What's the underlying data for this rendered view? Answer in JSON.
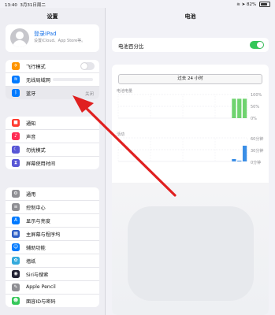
{
  "status": {
    "time": "13:40",
    "date": "3月31日周二",
    "battery": "82%",
    "battery_level": 0.82
  },
  "sidebar": {
    "title": "设置",
    "profile": {
      "title": "登录iPad",
      "subtitle": "设置iCloud、App Store等。"
    },
    "group1": [
      {
        "label": "飞行模式",
        "icon": "airplane-icon",
        "color": "#ff9500",
        "glyph": "✈"
      },
      {
        "label": "无线局域网",
        "icon": "wifi-icon",
        "color": "#007aff",
        "glyph": "≋"
      },
      {
        "label": "蓝牙",
        "icon": "bluetooth-icon",
        "color": "#007aff",
        "glyph": "ᛒ",
        "value": "关闭"
      }
    ],
    "group2": [
      {
        "label": "通知",
        "icon": "notification-icon",
        "color": "#ff3b30",
        "glyph": "■"
      },
      {
        "label": "声音",
        "icon": "sound-icon",
        "color": "#ff2d55",
        "glyph": "♪"
      },
      {
        "label": "勿扰模式",
        "icon": "moon-icon",
        "color": "#5856d6",
        "glyph": "☾"
      },
      {
        "label": "屏幕使用时间",
        "icon": "hourglass-icon",
        "color": "#5856d6",
        "glyph": "⧗"
      }
    ],
    "group3": [
      {
        "label": "通用",
        "icon": "gear-icon",
        "color": "#8e8e93",
        "glyph": "⚙"
      },
      {
        "label": "控制中心",
        "icon": "control-center-icon",
        "color": "#8e8e93",
        "glyph": "≡"
      },
      {
        "label": "显示与亮度",
        "icon": "display-icon",
        "color": "#007aff",
        "glyph": "A"
      },
      {
        "label": "主屏幕与程序坞",
        "icon": "home-screen-icon",
        "color": "#2c5cc5",
        "glyph": "▦"
      },
      {
        "label": "辅助功能",
        "icon": "accessibility-icon",
        "color": "#007aff",
        "glyph": "☺"
      },
      {
        "label": "墙纸",
        "icon": "wallpaper-icon",
        "color": "#34aadc",
        "glyph": "✿"
      },
      {
        "label": "Siri与搜索",
        "icon": "siri-icon",
        "color": "#222233",
        "glyph": "◉"
      },
      {
        "label": "Apple Pencil",
        "icon": "pencil-icon",
        "color": "#8e8e93",
        "glyph": "✎"
      },
      {
        "label": "面容ID与密码",
        "icon": "face-id-icon",
        "color": "#34c759",
        "glyph": "☻"
      }
    ]
  },
  "main": {
    "title": "电池",
    "battery_percentage_label": "电池百分比",
    "segment_label": "过去 24 小时",
    "battery_chart": {
      "label": "电池电量",
      "ticks": [
        "100%",
        "50%",
        "0%"
      ]
    },
    "activity_chart": {
      "label": "活动",
      "ticks": [
        "60分钟",
        "30分钟",
        "0分钟"
      ]
    }
  },
  "chart_data": [
    {
      "type": "bar",
      "title": "电池电量",
      "ylabel": "",
      "ylim": [
        0,
        100
      ],
      "x_count": 24,
      "values": [
        null,
        null,
        null,
        null,
        null,
        null,
        null,
        null,
        null,
        null,
        null,
        null,
        null,
        null,
        null,
        null,
        null,
        null,
        null,
        null,
        null,
        82,
        82,
        82
      ]
    },
    {
      "type": "bar",
      "title": "活动",
      "ylabel": "",
      "ylim": [
        0,
        60
      ],
      "x_count": 24,
      "values": [
        0,
        0,
        0,
        0,
        0,
        0,
        0,
        0,
        0,
        0,
        0,
        0,
        0,
        0,
        0,
        0,
        0,
        0,
        0,
        0,
        0,
        6,
        2,
        40
      ]
    }
  ]
}
